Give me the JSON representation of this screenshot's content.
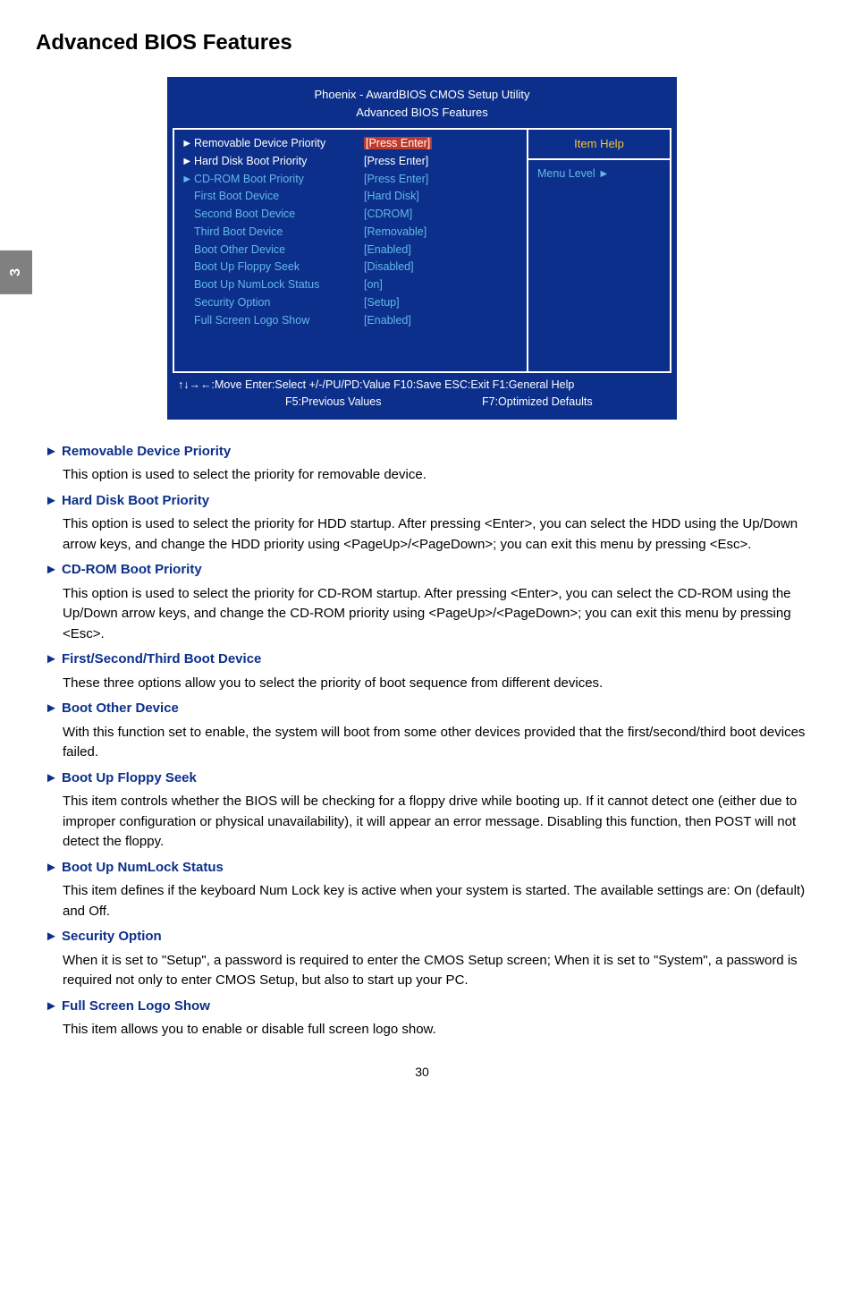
{
  "sideTab": "3",
  "pageTitle": "Advanced BIOS Features",
  "bios": {
    "titleLine1": "Phoenix - AwardBIOS CMOS Setup Utility",
    "titleLine2": "Advanced BIOS Features",
    "itemHelpLabel": "Item Help",
    "menuLevelLabel": "Menu Level  ►",
    "rows": [
      {
        "marker": "►",
        "label": "Removable Device Priority",
        "value": "[Press Enter]",
        "cls": "white",
        "valHighlight": true
      },
      {
        "marker": "►",
        "label": "Hard Disk Boot Priority",
        "value": "[Press Enter]",
        "cls": "white"
      },
      {
        "marker": "►",
        "label": "CD-ROM Boot Priority",
        "value": "[Press Enter]",
        "cls": "cyan"
      },
      {
        "marker": "",
        "label": "First Boot Device",
        "value": "[Hard Disk]",
        "cls": "cyan"
      },
      {
        "marker": "",
        "label": "Second Boot Device",
        "value": "[CDROM]",
        "cls": "cyan"
      },
      {
        "marker": "",
        "label": "Third Boot Device",
        "value": "[Removable]",
        "cls": "cyan"
      },
      {
        "marker": "",
        "label": "Boot Other Device",
        "value": "[Enabled]",
        "cls": "cyan"
      },
      {
        "marker": "",
        "label": "Boot Up Floppy Seek",
        "value": "[Disabled]",
        "cls": "cyan"
      },
      {
        "marker": "",
        "label": "Boot Up NumLock Status",
        "value": "[on]",
        "cls": "cyan"
      },
      {
        "marker": "",
        "label": "Security Option",
        "value": "[Setup]",
        "cls": "cyan"
      },
      {
        "marker": "",
        "label": "Full Screen Logo Show",
        "value": "[Enabled]",
        "cls": "cyan"
      }
    ],
    "footerLine1": "↑↓→←:Move   Enter:Select   +/-/PU/PD:Value   F10:Save   ESC:Exit  F1:General Help",
    "footerLine2a": "F5:Previous Values",
    "footerLine2b": "F7:Optimized Defaults"
  },
  "sections": [
    {
      "heading": "► Removable Device Priority",
      "body": "This option is used to select the priority for removable device."
    },
    {
      "heading": "► Hard Disk Boot Priority",
      "body": "This option is used to select the priority for HDD startup. After pressing <Enter>, you can select the HDD using the Up/Down arrow keys, and change the HDD priority using <PageUp>/<PageDown>; you can exit this menu by pressing <Esc>."
    },
    {
      "heading": "► CD-ROM Boot Priority",
      "body": "This option is used to select the priority for CD-ROM startup. After pressing <Enter>, you can select the CD-ROM using the Up/Down arrow keys, and change the CD-ROM priority using <PageUp>/<PageDown>; you can exit this menu by pressing <Esc>."
    },
    {
      "heading": "► First/Second/Third Boot Device",
      "body": "These three options allow you to select the priority of boot sequence from different devices."
    },
    {
      "heading": "► Boot Other Device",
      "body": "With this function set to enable, the system will boot from some other devices provided that the first/second/third boot devices failed."
    },
    {
      "heading": "► Boot Up Floppy Seek",
      "body": "This item controls whether the BIOS will be checking for a floppy drive while booting up. If it cannot detect one (either due to improper configuration or physical unavailability), it will appear an error message. Disabling this function, then POST will not detect the floppy."
    },
    {
      "heading": "► Boot Up NumLock Status",
      "body": "This item defines if the keyboard Num Lock key is active when your system is started. The available settings are: On (default) and Off."
    },
    {
      "heading": "► Security Option",
      "body": "When it is set to \"Setup\", a password is required to enter the CMOS Setup screen; When it is set to \"System\", a password is required not only to enter CMOS Setup, but also to start up your PC."
    },
    {
      "heading": "► Full Screen Logo Show",
      "body": "This item allows you to enable or disable full screen logo show."
    }
  ],
  "pageNumber": "30"
}
